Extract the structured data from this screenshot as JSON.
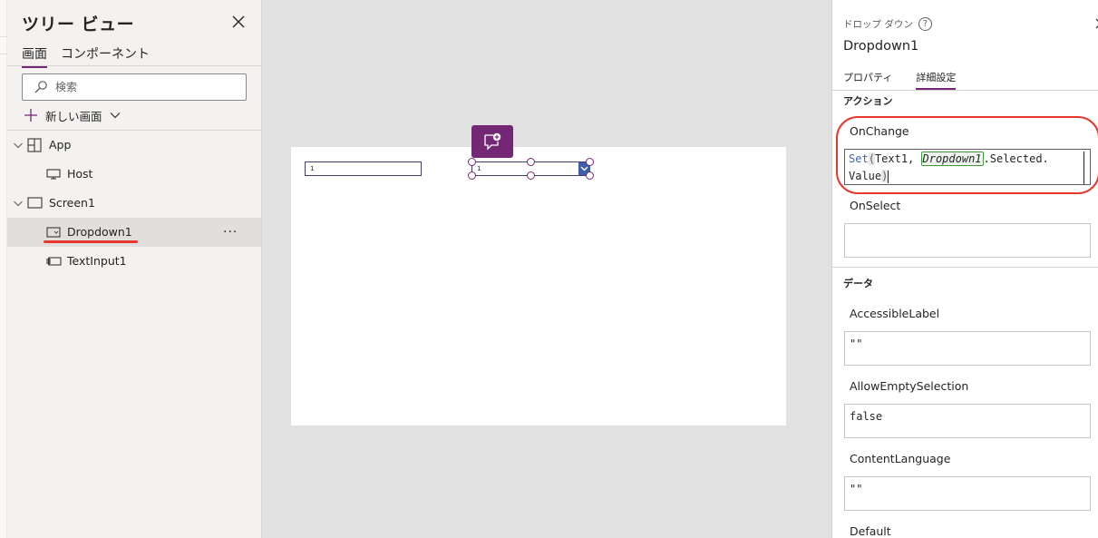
{
  "tree": {
    "title": "ツリー ビュー",
    "tabs": [
      {
        "label": "画面",
        "active": true
      },
      {
        "label": "コンポーネント",
        "active": false
      }
    ],
    "search": {
      "placeholder": "検索",
      "value": ""
    },
    "new_screen_label": "新しい画面",
    "nodes": [
      {
        "label": "App",
        "icon": "app-icon",
        "expanded": true
      },
      {
        "label": "Host",
        "icon": "host-icon"
      },
      {
        "label": "Screen1",
        "icon": "screen-icon",
        "expanded": true
      },
      {
        "label": "Dropdown1",
        "icon": "dropdown-icon",
        "selected": true,
        "more": "···"
      },
      {
        "label": "TextInput1",
        "icon": "textinput-icon"
      }
    ]
  },
  "canvas": {
    "textinput_value": "1",
    "dropdown_value": "1"
  },
  "panel": {
    "control_type": "ドロップ ダウン",
    "help": "?",
    "control_name": "Dropdown1",
    "tabs": [
      {
        "label": "プロパティ",
        "active": false
      },
      {
        "label": "詳細設定",
        "active": true
      }
    ],
    "section_action": "アクション",
    "onchange_label": "OnChange",
    "formula": {
      "fn": "Set",
      "open": "(",
      "arg1": "Text1, ",
      "control": "Dropdown1",
      "rest": ".Selected.",
      "line2": "Value",
      "close": ")"
    },
    "onselect_label": "OnSelect",
    "onselect_value": "",
    "section_data": "データ",
    "fields": [
      {
        "label": "AccessibleLabel",
        "value": "\"\""
      },
      {
        "label": "AllowEmptySelection",
        "value": "false"
      },
      {
        "label": "ContentLanguage",
        "value": "\"\""
      },
      {
        "label": "Default",
        "value": ""
      }
    ]
  },
  "colors": {
    "accent": "#742774",
    "annotation_red": "#e8382c",
    "dropdown_arrow": "#3e5dab",
    "canvas_bg": "#e1e1e1"
  }
}
